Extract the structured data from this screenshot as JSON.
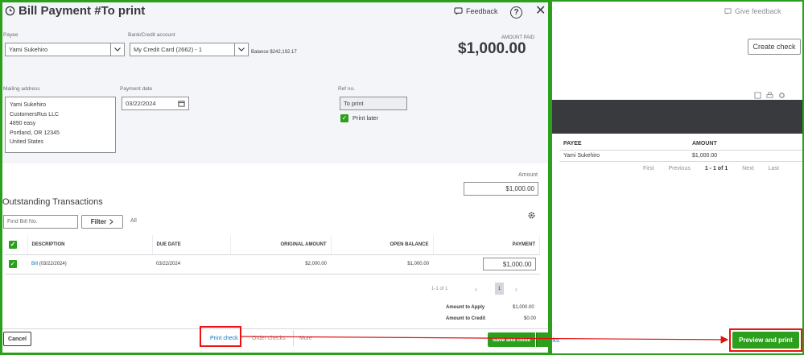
{
  "modal": {
    "title": "Bill Payment #To print",
    "feedback_label": "Feedback",
    "help_label": "?",
    "close_label": "✕",
    "payee": {
      "label": "Payee",
      "value": "Yami Sukehiro"
    },
    "bank": {
      "label": "Bank/Credit account",
      "value": "My Credit Card (2662) - 1",
      "balance_label": "Balance",
      "balance_value": "$242,192.17"
    },
    "amount_paid": {
      "label": "AMOUNT PAID",
      "value": "$1,000.00"
    },
    "mailing": {
      "label": "Mailing address",
      "lines": [
        "Yami Sukehiro",
        "CustomersRus LLC",
        "4890 easy",
        "Portland, OR  12345",
        "United States"
      ]
    },
    "payment_date": {
      "label": "Payment date",
      "value": "03/22/2024"
    },
    "ref": {
      "label": "Ref no.",
      "value": "To print",
      "print_later": "Print later"
    },
    "amount": {
      "label": "Amount",
      "value": "$1,000.00"
    },
    "outstanding": {
      "title": "Outstanding Transactions",
      "find_placeholder": "Find Bill No.",
      "filter_label": "Filter",
      "all_label": "All",
      "headers": [
        "DESCRIPTION",
        "DUE DATE",
        "ORIGINAL AMOUNT",
        "OPEN BALANCE",
        "PAYMENT"
      ],
      "rows": [
        {
          "description": "Bill",
          "desc_date": "(03/22/2024)",
          "due_date": "03/22/2024",
          "original": "$2,000.00",
          "open": "$1,000.00",
          "payment": "$1,000.00"
        }
      ],
      "pager": {
        "range": "1-1 of 1",
        "page": "1"
      }
    },
    "totals": {
      "apply_label": "Amount to Apply",
      "apply_value": "$1,000.00",
      "credit_label": "Amount to Credit",
      "credit_value": "$0.00"
    },
    "footer": {
      "cancel": "Cancel",
      "print_check": "Print check",
      "order_checks": "Order checks",
      "more": "More",
      "save_close": "Save and close"
    }
  },
  "background": {
    "give_feedback": "Give feedback",
    "create_check": "Create check",
    "headers": [
      "PAYEE",
      "AMOUNT"
    ],
    "row": {
      "payee": "Yami Sukehiro",
      "amount": "$1,000.00"
    },
    "pager": {
      "first": "First",
      "previous": "Previous",
      "range": "1 - 1 of 1",
      "next": "Next",
      "last": "Last"
    },
    "checks_partial": "cks",
    "preview_print": "Preview and print"
  },
  "colors": {
    "accent_green": "#2ca01c",
    "annotation_red": "#e11111",
    "link_blue": "#0077c5"
  }
}
